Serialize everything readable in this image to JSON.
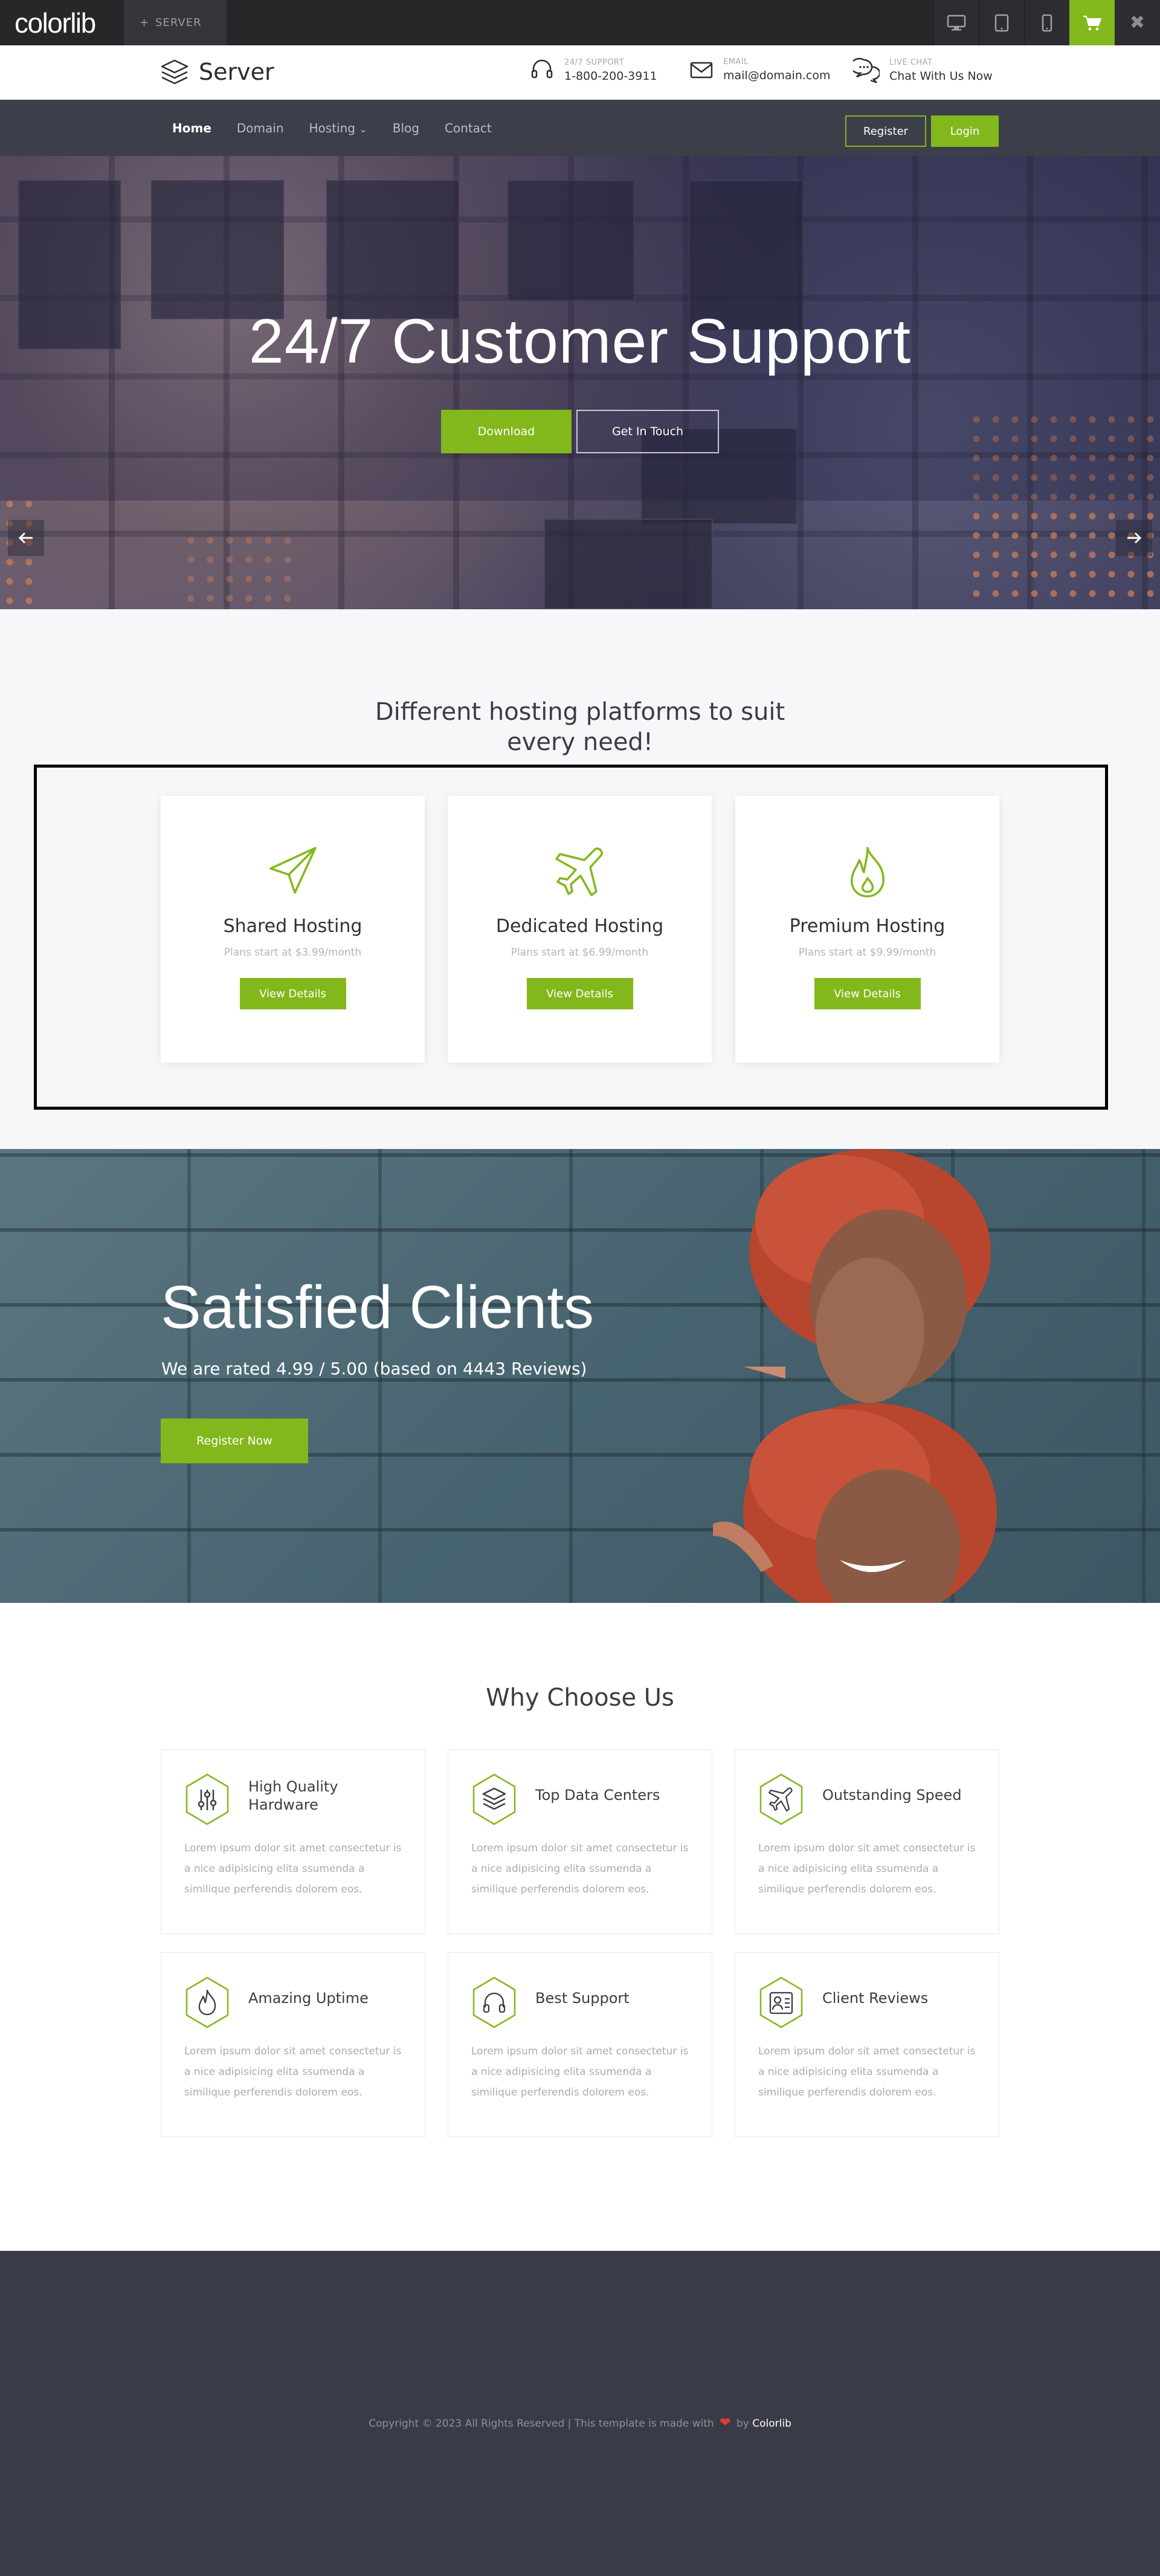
{
  "preview_bar": {
    "logo": "colorlib",
    "tab_label": "SERVER",
    "tab_prefix": "+",
    "close_glyph": "✖"
  },
  "header": {
    "brand": "Server",
    "support_label": "24/7 SUPPORT",
    "support_value": "1-800-200-3911",
    "email_label": "EMAIL",
    "email_value": "mail@domain.com",
    "chat_label": "LIVE CHAT",
    "chat_value": "Chat With Us Now"
  },
  "nav": {
    "items": [
      {
        "label": "Home"
      },
      {
        "label": "Domain"
      },
      {
        "label": "Hosting"
      },
      {
        "label": "Blog"
      },
      {
        "label": "Contact"
      }
    ],
    "hosting_caret": "⌄",
    "register": "Register",
    "login": "Login"
  },
  "hero": {
    "title": "24/7 Customer Support",
    "download": "Download",
    "get_in_touch": "Get In Touch"
  },
  "platforms": {
    "heading_line1": "Different hosting platforms to suit",
    "heading_line2": "every need!",
    "cards": [
      {
        "title": "Shared Hosting",
        "sub": "Plans start at $3.99/month",
        "button": "View Details",
        "icon": "paper-plane-icon"
      },
      {
        "title": "Dedicated Hosting",
        "sub": "Plans start at $6.99/month",
        "button": "View Details",
        "icon": "airplane-icon"
      },
      {
        "title": "Premium Hosting",
        "sub": "Plans start at $9.99/month",
        "button": "View Details",
        "icon": "flame-icon"
      }
    ]
  },
  "clients": {
    "title": "Satisfied Clients",
    "rating": "We are rated 4.99 / 5.00 (based on 4443 Reviews)",
    "button": "Register Now"
  },
  "why": {
    "heading": "Why Choose Us",
    "features": [
      {
        "title": "High Quality Hardware",
        "desc": "Lorem ipsum dolor sit amet consectetur is a nice adipisicing elita ssumenda a similique perferendis dolorem eos.",
        "icon": "sliders-icon"
      },
      {
        "title": "Top Data Centers",
        "desc": "Lorem ipsum dolor sit amet consectetur is a nice adipisicing elita ssumenda a similique perferendis dolorem eos.",
        "icon": "layers-icon"
      },
      {
        "title": "Outstanding Speed",
        "desc": "Lorem ipsum dolor sit amet consectetur is a nice adipisicing elita ssumenda a similique perferendis dolorem eos.",
        "icon": "airplane-icon"
      },
      {
        "title": "Amazing Uptime",
        "desc": "Lorem ipsum dolor sit amet consectetur is a nice adipisicing elita ssumenda a similique perferendis dolorem eos.",
        "icon": "flame-icon"
      },
      {
        "title": "Best Support",
        "desc": "Lorem ipsum dolor sit amet consectetur is a nice adipisicing elita ssumenda a similique perferendis dolorem eos.",
        "icon": "headphones-icon"
      },
      {
        "title": "Client Reviews",
        "desc": "Lorem ipsum dolor sit amet consectetur is a nice adipisicing elita ssumenda a similique perferendis dolorem eos.",
        "icon": "user-list-icon"
      }
    ]
  },
  "footer": {
    "copyright": "Copyright © 2023 All Rights Reserved | This template is made with",
    "by": "by",
    "author": "Colorlib"
  },
  "colors": {
    "accent": "#82b81b",
    "nav_bg": "#3c3f4a",
    "footer_bg": "#393c46"
  }
}
